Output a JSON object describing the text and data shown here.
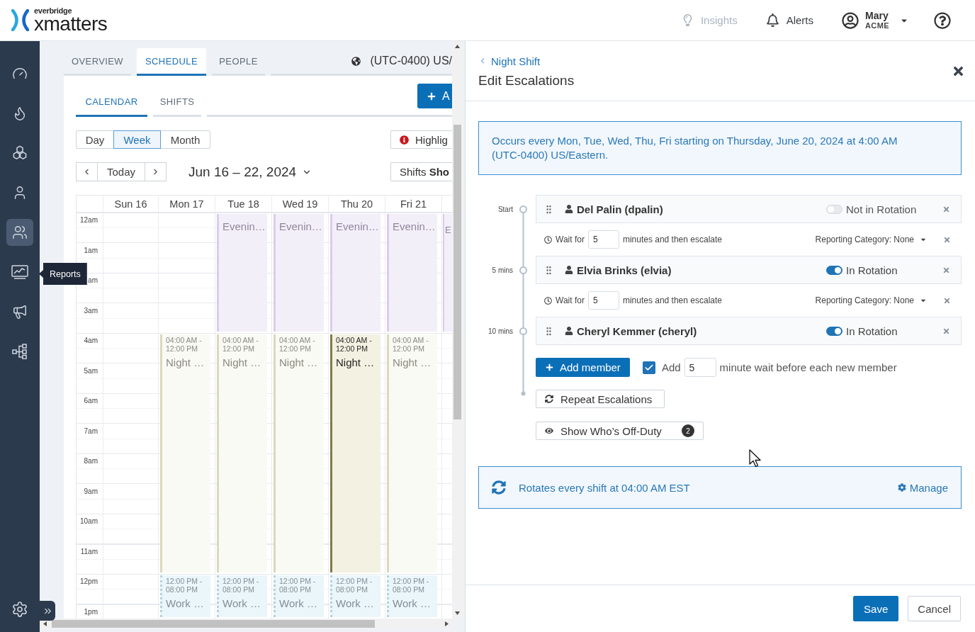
{
  "header": {
    "logo": {
      "tagline": "everbridge",
      "name": "xmatters"
    },
    "insights": {
      "label": "Insights",
      "disabled": true
    },
    "alerts": {
      "label": "Alerts",
      "disabled": false
    },
    "user": {
      "name": "Mary",
      "org": "ACME"
    }
  },
  "nav": {
    "items": [
      {
        "kind": "gauge",
        "selected": false
      },
      {
        "kind": "flame",
        "selected": false
      },
      {
        "kind": "hexagons",
        "selected": false
      },
      {
        "kind": "person",
        "selected": false
      },
      {
        "kind": "people",
        "selected": true
      },
      {
        "kind": "chart",
        "selected": false,
        "tooltip": "Reports"
      },
      {
        "kind": "megaphone",
        "selected": false
      },
      {
        "kind": "hierarchy",
        "selected": false
      }
    ]
  },
  "tabs": [
    {
      "label": "OVERVIEW",
      "selected": false
    },
    {
      "label": "SCHEDULE",
      "selected": true
    },
    {
      "label": "PEOPLE",
      "selected": false
    }
  ],
  "timezone": "(UTC-0400) US/",
  "subtabs": [
    {
      "label": "CALENDAR",
      "selected": true
    },
    {
      "label": "SHIFTS",
      "selected": false
    }
  ],
  "add_button": "A",
  "views": [
    {
      "label": "Day",
      "selected": false
    },
    {
      "label": "Week",
      "selected": true
    },
    {
      "label": "Month",
      "selected": false
    }
  ],
  "highlight_button": "Highlig",
  "today_button": "Today",
  "date_range": "Jun 16 – 22, 2024",
  "shifts_filter": "Shifts **Sho**",
  "calendar": {
    "hours": [
      "12am",
      "1am",
      "am",
      "3am",
      "4am",
      "5am",
      "6am",
      "7am",
      "8am",
      "9am",
      "10am",
      "11am",
      "12pm",
      "1pm"
    ],
    "days": [
      {
        "label": "Sun 16"
      },
      {
        "label": "Mon 17",
        "events": [
          {
            "kind": "night",
            "time": "04:00 AM - 12:00 PM",
            "title": "Night …",
            "selected": false
          },
          {
            "kind": "work",
            "time": "12:00 PM - 08:00 PM",
            "title": "Work …",
            "selected": false
          }
        ]
      },
      {
        "label": "Tue 18",
        "events": [
          {
            "kind": "evening",
            "title": "Evenin…",
            "selected": false
          },
          {
            "kind": "night",
            "time": "04:00 AM - 12:00 PM",
            "title": "Night …",
            "selected": false
          },
          {
            "kind": "work",
            "time": "12:00 PM - 08:00 PM",
            "title": "Work …",
            "selected": false
          }
        ]
      },
      {
        "label": "Wed 19",
        "events": [
          {
            "kind": "evening",
            "title": "Evenin…",
            "selected": false
          },
          {
            "kind": "night",
            "time": "04:00 AM - 12:00 PM",
            "title": "Night …",
            "selected": false
          },
          {
            "kind": "work",
            "time": "12:00 PM - 08:00 PM",
            "title": "Work …",
            "selected": false
          }
        ]
      },
      {
        "label": "Thu 20",
        "events": [
          {
            "kind": "evening",
            "title": "Evenin…",
            "selected": false
          },
          {
            "kind": "night",
            "time": "04:00 AM - 12:00 PM",
            "title": "Night …",
            "selected": true
          },
          {
            "kind": "work",
            "time": "12:00 PM - 08:00 PM",
            "title": "Work …",
            "selected": false
          }
        ]
      },
      {
        "label": "Fri 21",
        "events": [
          {
            "kind": "evening",
            "title": "Evenin…",
            "selected": false
          },
          {
            "kind": "night",
            "time": "04:00 AM - 12:00 PM",
            "title": "Night …",
            "selected": false
          },
          {
            "kind": "work",
            "time": "12:00 PM - 08:00 PM",
            "title": "Work …",
            "selected": false
          }
        ]
      },
      {
        "events": [
          {
            "kind": "evening",
            "title": "E",
            "selected": false
          }
        ]
      }
    ]
  },
  "panel": {
    "back_link": "Night Shift",
    "title": "Edit Escalations",
    "summary": "Occurs every Mon, Tue, Wed, Thu, Fri starting on Thursday, June 20, 2024 at 4:00 AM (UTC-0400) US/Eastern.",
    "escalation": [
      {
        "kind": "member",
        "marker": "Start",
        "name": "Del Palin (dpalin)",
        "in_rotation": false,
        "rotation_label": "Not in Rotation"
      },
      {
        "kind": "wait",
        "prefix": "Wait for",
        "value": "5",
        "suffix": "minutes and then escalate",
        "category": "Reporting Category: None"
      },
      {
        "kind": "member",
        "marker": "5 mins",
        "name": "Elvia Brinks (elvia)",
        "in_rotation": true,
        "rotation_label": "In Rotation"
      },
      {
        "kind": "wait",
        "prefix": "Wait for",
        "value": "5",
        "suffix": "minutes and then escalate",
        "category": "Reporting Category: None"
      },
      {
        "kind": "member",
        "marker": "10 mins",
        "name": "Cheryl Kemmer (cheryl)",
        "in_rotation": true,
        "rotation_label": "In Rotation"
      }
    ],
    "add_member": "Add member",
    "auto_wait": {
      "checked": true,
      "prefix": "Add",
      "value": "5",
      "suffix": "minute wait before each new member"
    },
    "repeat_button": "Repeat Escalations",
    "off_duty": {
      "label": "Show Who’s Off-Duty",
      "count": "2"
    },
    "rotation": {
      "text": "Rotates every shift at 04:00 AM EST",
      "manage": "Manage"
    },
    "footer": {
      "save": "Save",
      "cancel": "Cancel"
    }
  }
}
